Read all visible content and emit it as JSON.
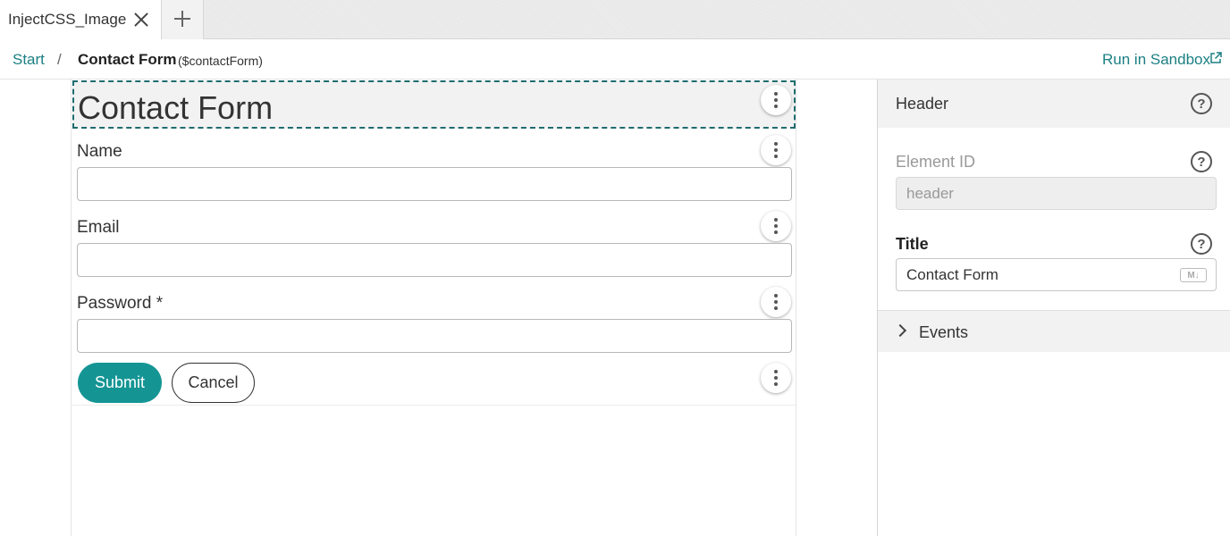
{
  "tabs": {
    "active_label": "InjectCSS_Image"
  },
  "breadcrumb": {
    "start": "Start",
    "separator": "/",
    "current": "Contact Form",
    "current_id": "($contactForm)",
    "sandbox_link": "Run in Sandbox"
  },
  "form": {
    "title": "Contact Form",
    "fields": [
      {
        "label": "Name"
      },
      {
        "label": "Email"
      },
      {
        "label": "Password *"
      }
    ],
    "submit_label": "Submit",
    "cancel_label": "Cancel"
  },
  "panel": {
    "header": "Header",
    "element_id_label": "Element ID",
    "element_id_value": "header",
    "title_label": "Title",
    "title_value": "Contact Form",
    "markdown_badge": "M↓",
    "events_label": "Events",
    "help_glyph": "?"
  },
  "colors": {
    "accent": "#149594",
    "link": "#1b7f83",
    "selection_outline": "#1e6c6e"
  }
}
